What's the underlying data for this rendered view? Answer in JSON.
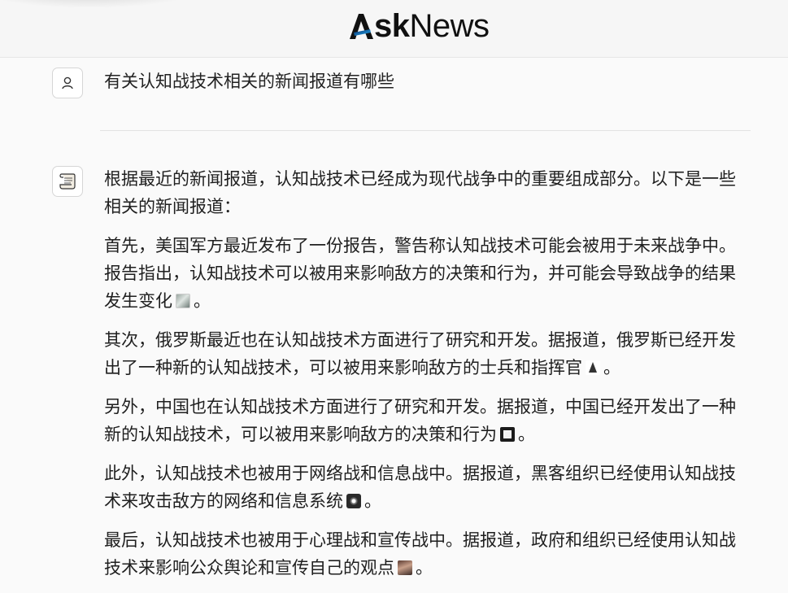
{
  "app": {
    "logo_text_bold": "sk",
    "logo_text_regular": "News",
    "logo_letter": "A"
  },
  "question": {
    "text": "有关认知战技术相关的新闻报道有哪些"
  },
  "answer": {
    "paragraphs": [
      "根据最近的新闻报道，认知战技术已经成为现代战争中的重要组成部分。以下是一些相关的新闻报道：",
      "首先，美国军方最近发布了一份报告，警告称认知战技术可能会被用于未来战争中。报告指出，认知战技术可以被用来影响敌方的决策和行为，并可能会导致战争的结果发生变化",
      "其次，俄罗斯最近也在认知战技术方面进行了研究和开发。据报道，俄罗斯已经开发出了一种新的认知战技术，可以被用来影响敌方的士兵和指挥官",
      "另外，中国也在认知战技术方面进行了研究和开发。据报道，中国已经开发出了一种新的认知战技术，可以被用来影响敌方的决策和行为",
      "此外，认知战技术也被用于网络战和信息战中。据报道，黑客组织已经使用认知战技术来攻击敌方的网络和信息系统",
      "最后，认知战技术也被用于心理战和宣传战中。据报道，政府和组织已经使用认知战技术来影响公众舆论和宣传自己的观点"
    ],
    "end_mark": "。"
  },
  "icons": {
    "user_avatar": "user-icon",
    "bot_avatar": "scroll-icon",
    "source_thumbs": [
      "source-thumbnail",
      "source-thumbnail",
      "source-thumbnail",
      "source-thumbnail",
      "source-thumbnail"
    ]
  },
  "colors": {
    "background": "#fafafa",
    "header_bg": "#f6f6f6",
    "logo_blue": "#1a9be8",
    "text": "#1f1f1f"
  }
}
